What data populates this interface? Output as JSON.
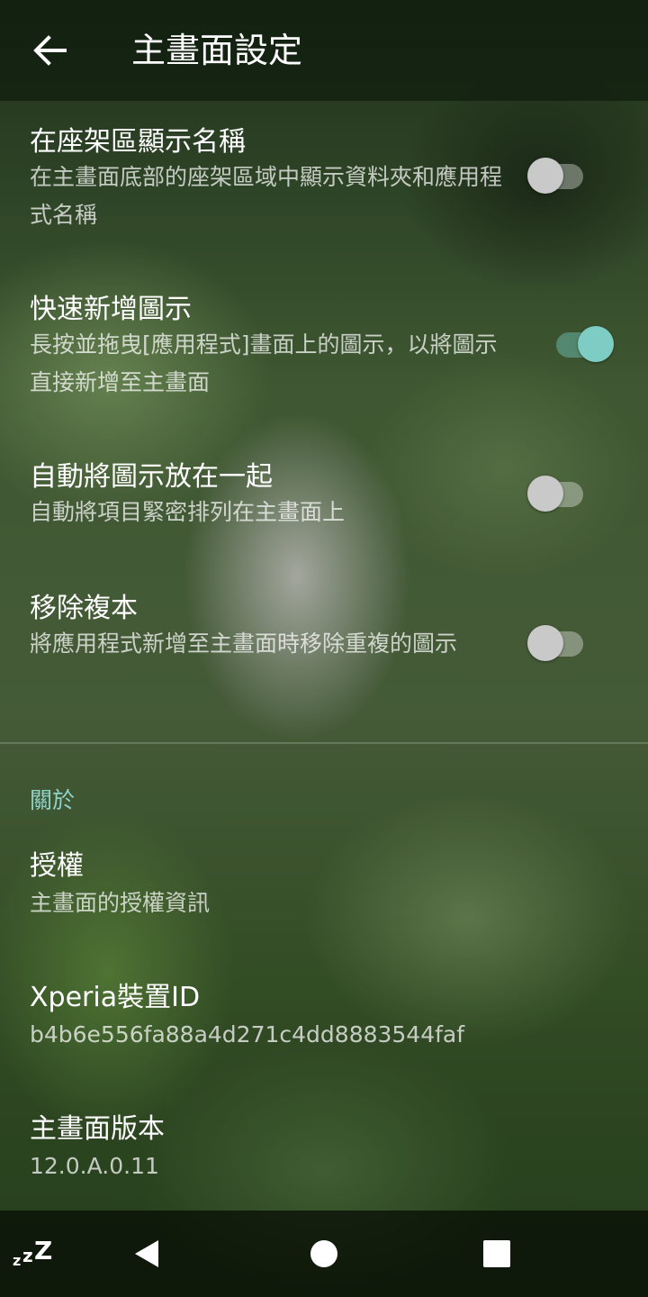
{
  "header": {
    "title": "主畫面設定"
  },
  "settings": [
    {
      "title": "在座架區顯示名稱",
      "subtitle": "在主畫面底部的座架區域中顯示資料夾和應用程式名稱",
      "enabled": false
    },
    {
      "title": "快速新增圖示",
      "subtitle": "長按並拖曳[應用程式]畫面上的圖示，以將圖示直接新增至主畫面",
      "enabled": true
    },
    {
      "title": "自動將圖示放在一起",
      "subtitle": "自動將項目緊密排列在主畫面上",
      "enabled": false
    },
    {
      "title": "移除複本",
      "subtitle": "將應用程式新增至主畫面時移除重複的圖示",
      "enabled": false
    }
  ],
  "about": {
    "header": "關於",
    "items": [
      {
        "title": "授權",
        "subtitle": "主畫面的授權資訊"
      },
      {
        "title": "Xperia裝置ID",
        "subtitle": "b4b6e556fa88a4d271c4dd8883544faf"
      },
      {
        "title": "主畫面版本",
        "subtitle": "12.0.A.0.11"
      }
    ]
  },
  "navbar": {
    "icons": [
      "sleep-zzz-icon",
      "back-triangle-icon",
      "home-circle-icon",
      "recents-square-icon"
    ]
  },
  "colors": {
    "accent": "#7ecdc4",
    "section_header": "#8fd3c8"
  }
}
